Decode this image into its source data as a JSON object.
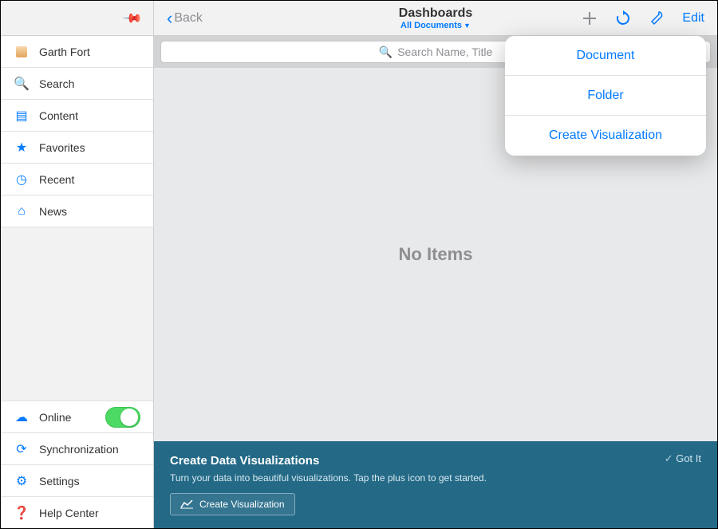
{
  "sidebar": {
    "user": {
      "name": "Garth Fort"
    },
    "items": [
      {
        "icon": "search-icon",
        "glyph": "🔍",
        "label": "Search"
      },
      {
        "icon": "content-icon",
        "glyph": "▤",
        "label": "Content"
      },
      {
        "icon": "star-icon",
        "glyph": "★",
        "label": "Favorites"
      },
      {
        "icon": "clock-icon",
        "glyph": "◷",
        "label": "Recent"
      },
      {
        "icon": "home-icon",
        "glyph": "⌂",
        "label": "News"
      }
    ],
    "bottom": {
      "online_label": "Online",
      "online_on": true,
      "sync_label": "Synchronization",
      "settings_label": "Settings",
      "help_label": "Help Center"
    }
  },
  "topbar": {
    "back_label": "Back",
    "title": "Dashboards",
    "subtitle": "All Documents",
    "edit_label": "Edit"
  },
  "search": {
    "placeholder": "Search Name, Title"
  },
  "content": {
    "empty_label": "No Items"
  },
  "popover": {
    "items": [
      {
        "label": "Document"
      },
      {
        "label": "Folder"
      },
      {
        "label": "Create Visualization"
      }
    ]
  },
  "banner": {
    "title": "Create Data Visualizations",
    "body": "Turn your data into beautiful visualizations. Tap the plus icon to get started.",
    "cta": "Create Visualization",
    "gotit": "Got It"
  }
}
